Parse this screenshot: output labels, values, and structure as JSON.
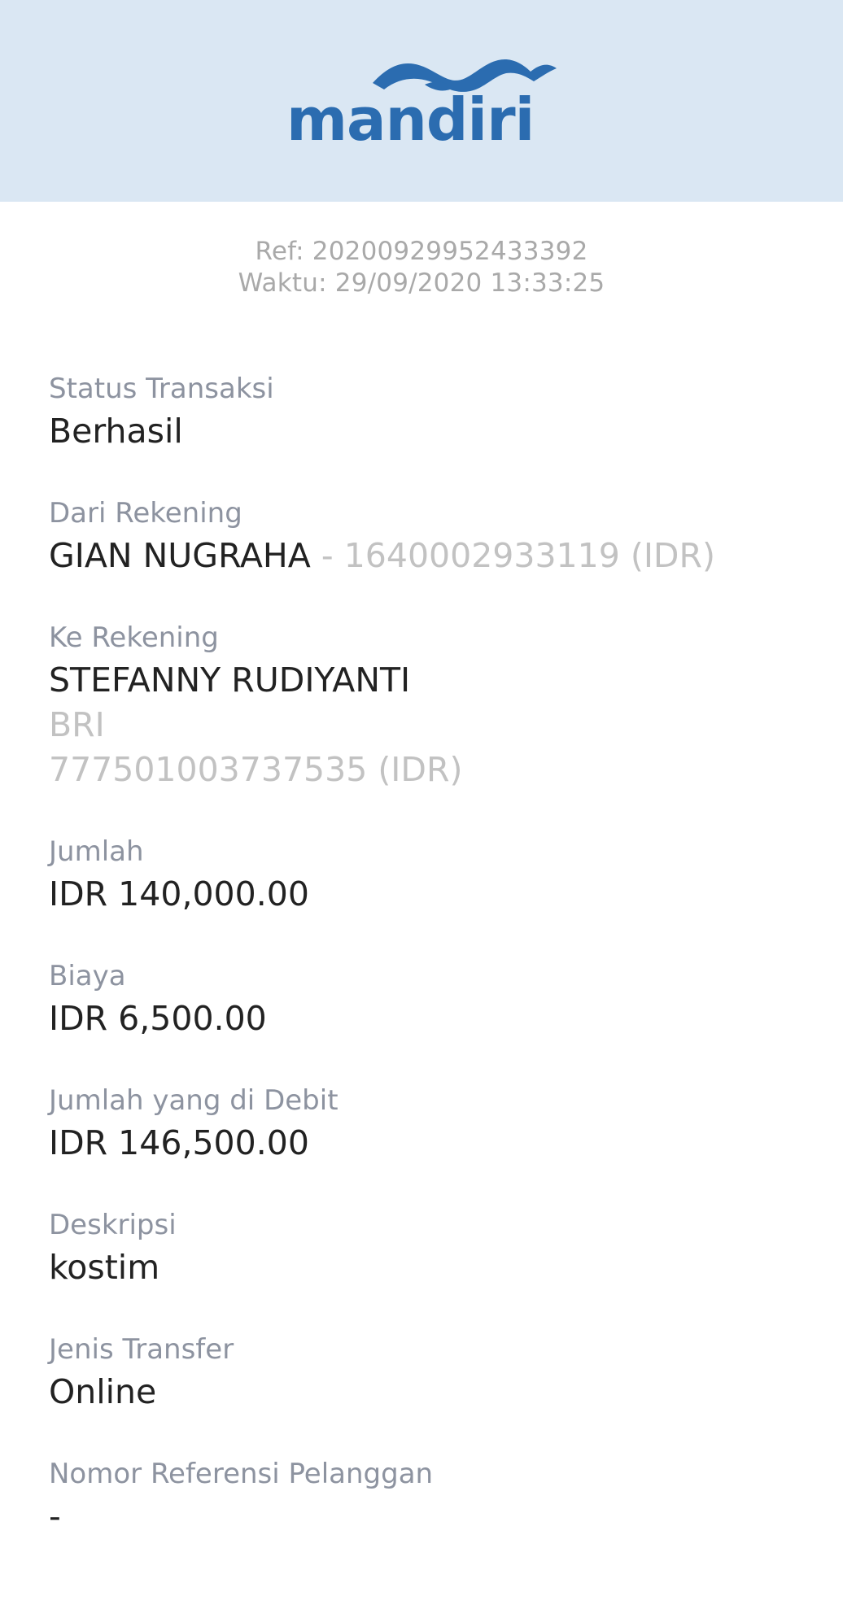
{
  "header": {
    "brand": "mandiri",
    "brand_color": "#2b6cb0",
    "background": "#dae7f3"
  },
  "meta": {
    "ref": "Ref: 20200929952433392",
    "time": "Waktu: 29/09/2020 13:33:25"
  },
  "fields": {
    "status": {
      "label": "Status Transaksi",
      "value": "Berhasil"
    },
    "from": {
      "label": "Dari Rekening",
      "name": "GIAN NUGRAHA",
      "account": " - 1640002933119 (IDR)"
    },
    "to": {
      "label": "Ke Rekening",
      "name": "STEFANNY RUDIYANTI",
      "bank": "BRI",
      "account": "777501003737535 (IDR)"
    },
    "amount": {
      "label": "Jumlah",
      "value": "IDR 140,000.00"
    },
    "fee": {
      "label": "Biaya",
      "value": "IDR 6,500.00"
    },
    "debited": {
      "label": "Jumlah yang di Debit",
      "value": "IDR 146,500.00"
    },
    "description": {
      "label": "Deskripsi",
      "value": "kostim"
    },
    "transfer_type": {
      "label": "Jenis Transfer",
      "value": "Online"
    },
    "customer_ref": {
      "label": "Nomor Referensi Pelanggan",
      "value": "-"
    }
  }
}
